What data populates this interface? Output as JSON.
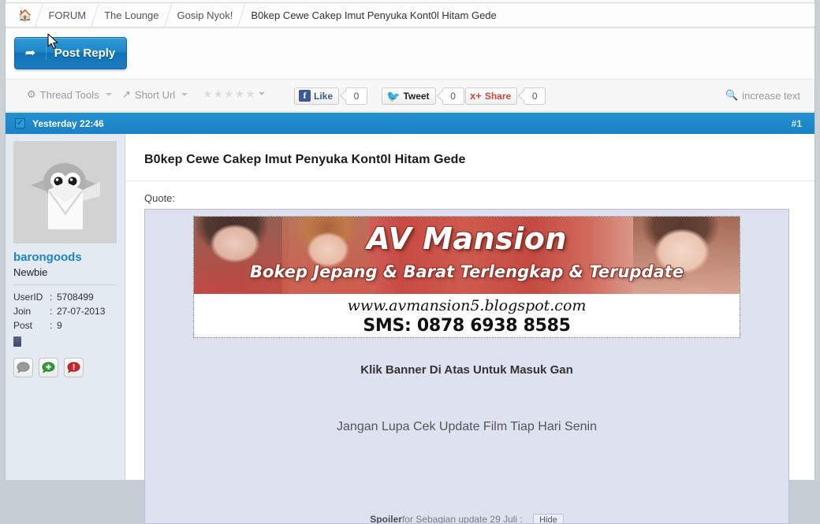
{
  "breadcrumb": {
    "home_icon": "home-icon",
    "items": [
      {
        "label": "FORUM"
      },
      {
        "label": "The Lounge"
      },
      {
        "label": "Gosip Nyok!"
      },
      {
        "label": "B0kep Cewe Cakep Imut Penyuka Kont0l Hitam Gede"
      }
    ]
  },
  "actionbar": {
    "post_reply_label": "Post Reply",
    "post_reply_icon": "reply-arrow-icon"
  },
  "toolsbar": {
    "thread_tools_label": "Thread Tools",
    "thread_tools_icon": "gear-icon",
    "short_url_label": "Short Url",
    "short_url_icon": "external-link-icon",
    "rating_stars": 5,
    "rating_filled": 0,
    "facebook": {
      "label": "Like",
      "count": "0",
      "glyph": "f"
    },
    "twitter": {
      "label": "Tweet",
      "count": "0",
      "glyph": "bird"
    },
    "googleplus": {
      "label": "Share",
      "count": "0",
      "glyph": "g-plus"
    },
    "increase_text_label": "increase text",
    "increase_text_icon": "magnifier-icon"
  },
  "post_header": {
    "checkbox_icon": "checkbox-checked-icon",
    "date": "Yesterday 22:46",
    "post_number": "#1"
  },
  "user": {
    "avatar_icon": "bird-envelope-avatar",
    "name": "barongoods",
    "rank": "Newbie",
    "stats": [
      {
        "key": "UserID",
        "sep": ":",
        "value": "5708499"
      },
      {
        "key": "Join",
        "sep": ":",
        "value": "27-07-2013"
      },
      {
        "key": "Post",
        "sep": ":",
        "value": "9"
      }
    ],
    "badge_icon": "member-badge-icon",
    "buttons": [
      {
        "name": "user-offline-status-icon"
      },
      {
        "name": "add-reputation-icon"
      },
      {
        "name": "report-post-icon"
      }
    ]
  },
  "post": {
    "title": "B0kep Cewe Cakep Imut Penyuka Kont0l Hitam Gede",
    "quote_label": "Quote:",
    "banner": {
      "title": "AV Mansion",
      "subtitle": "Bokep Jepang & Barat Terlengkap & Terupdate",
      "url": "www.avmansion5.blogspot.com",
      "sms": "SMS: 0878 6938 8585"
    },
    "line_1": "Klik Banner Di Atas Untuk Masuk Gan",
    "line_2": "Jangan Lupa Cek Update Film Tiap Hari Senin",
    "spoiler_label": "Spoiler",
    "spoiler_text": "for Sebagian update 29 Juli :",
    "spoiler_button": "Hide"
  },
  "colors": {
    "accent_blue": "#1b82c4",
    "link_blue": "#1c84c6",
    "quote_bg": "#dee2f0",
    "user_panel_bg": "#e4eaf2",
    "page_bg": "#c9d0d6"
  }
}
